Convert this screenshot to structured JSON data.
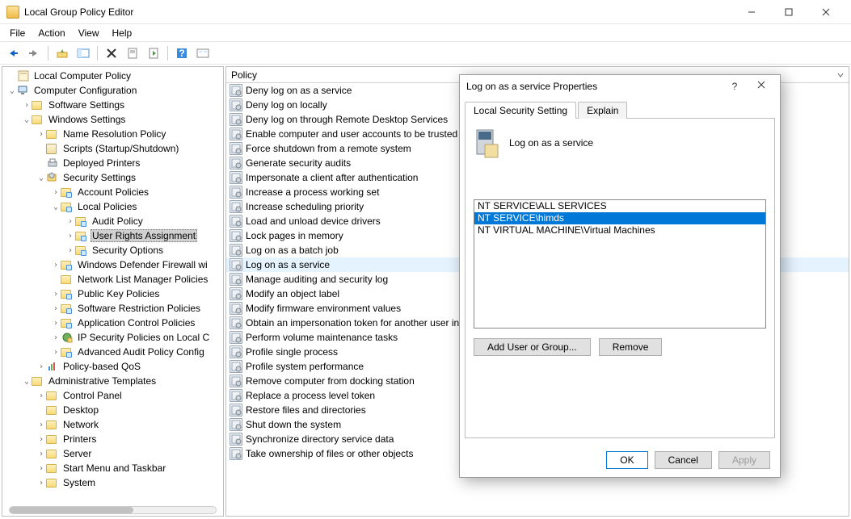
{
  "title": "Local Group Policy Editor",
  "menu": [
    "File",
    "Action",
    "View",
    "Help"
  ],
  "tree": [
    {
      "d": 0,
      "exp": "",
      "icon": "root",
      "label": "Local Computer Policy"
    },
    {
      "d": 0,
      "exp": "v",
      "icon": "comp",
      "label": "Computer Configuration"
    },
    {
      "d": 1,
      "exp": ">",
      "icon": "folder",
      "label": "Software Settings"
    },
    {
      "d": 1,
      "exp": "v",
      "icon": "folder",
      "label": "Windows Settings"
    },
    {
      "d": 2,
      "exp": ">",
      "icon": "folder",
      "label": "Name Resolution Policy"
    },
    {
      "d": 2,
      "exp": "",
      "icon": "scroll",
      "label": "Scripts (Startup/Shutdown)"
    },
    {
      "d": 2,
      "exp": "",
      "icon": "printer",
      "label": "Deployed Printers"
    },
    {
      "d": 2,
      "exp": "v",
      "icon": "sec",
      "label": "Security Settings"
    },
    {
      "d": 3,
      "exp": ">",
      "icon": "folderb",
      "label": "Account Policies"
    },
    {
      "d": 3,
      "exp": "v",
      "icon": "folderb",
      "label": "Local Policies"
    },
    {
      "d": 4,
      "exp": ">",
      "icon": "folderb",
      "label": "Audit Policy"
    },
    {
      "d": 4,
      "exp": ">",
      "icon": "folderb",
      "label": "User Rights Assignment",
      "sel": true
    },
    {
      "d": 4,
      "exp": ">",
      "icon": "folderb",
      "label": "Security Options"
    },
    {
      "d": 3,
      "exp": ">",
      "icon": "folderb",
      "label": "Windows Defender Firewall wi"
    },
    {
      "d": 3,
      "exp": "",
      "icon": "folder",
      "label": "Network List Manager Policies"
    },
    {
      "d": 3,
      "exp": ">",
      "icon": "folderb",
      "label": "Public Key Policies"
    },
    {
      "d": 3,
      "exp": ">",
      "icon": "folderb",
      "label": "Software Restriction Policies"
    },
    {
      "d": 3,
      "exp": ">",
      "icon": "folderb",
      "label": "Application Control Policies"
    },
    {
      "d": 3,
      "exp": ">",
      "icon": "ipsec",
      "label": "IP Security Policies on Local C"
    },
    {
      "d": 3,
      "exp": ">",
      "icon": "folderb",
      "label": "Advanced Audit Policy Config"
    },
    {
      "d": 2,
      "exp": ">",
      "icon": "qos",
      "label": "Policy-based QoS"
    },
    {
      "d": 1,
      "exp": "v",
      "icon": "folder",
      "label": "Administrative Templates"
    },
    {
      "d": 2,
      "exp": ">",
      "icon": "folder",
      "label": "Control Panel"
    },
    {
      "d": 2,
      "exp": "",
      "icon": "folder",
      "label": "Desktop"
    },
    {
      "d": 2,
      "exp": ">",
      "icon": "folder",
      "label": "Network"
    },
    {
      "d": 2,
      "exp": ">",
      "icon": "folder",
      "label": "Printers"
    },
    {
      "d": 2,
      "exp": ">",
      "icon": "folder",
      "label": "Server"
    },
    {
      "d": 2,
      "exp": ">",
      "icon": "folder",
      "label": "Start Menu and Taskbar"
    },
    {
      "d": 2,
      "exp": ">",
      "icon": "folder",
      "label": "System"
    }
  ],
  "policy_header": "Policy",
  "policies": [
    "Deny log on as a service",
    "Deny log on locally",
    "Deny log on through Remote Desktop Services",
    "Enable computer and user accounts to be trusted",
    "Force shutdown from a remote system",
    "Generate security audits",
    "Impersonate a client after authentication",
    "Increase a process working set",
    "Increase scheduling priority",
    "Load and unload device drivers",
    "Lock pages in memory",
    "Log on as a batch job",
    "Log on as a service",
    "Manage auditing and security log",
    "Modify an object label",
    "Modify firmware environment values",
    "Obtain an impersonation token for another user in",
    "Perform volume maintenance tasks",
    "Profile single process",
    "Profile system performance",
    "Remove computer from docking station",
    "Replace a process level token",
    "Restore files and directories",
    "Shut down the system",
    "Synchronize directory service data",
    "Take ownership of files or other objects"
  ],
  "policy_selected_index": 12,
  "dialog": {
    "title": "Log on as a service Properties",
    "tabs": [
      "Local Security Setting",
      "Explain"
    ],
    "policy_name": "Log on as a service",
    "members": [
      "NT SERVICE\\ALL SERVICES",
      "NT SERVICE\\himds",
      "NT VIRTUAL MACHINE\\Virtual Machines"
    ],
    "selected_member_index": 1,
    "buttons": {
      "add": "Add User or Group...",
      "remove": "Remove"
    },
    "footer": {
      "ok": "OK",
      "cancel": "Cancel",
      "apply": "Apply"
    }
  }
}
